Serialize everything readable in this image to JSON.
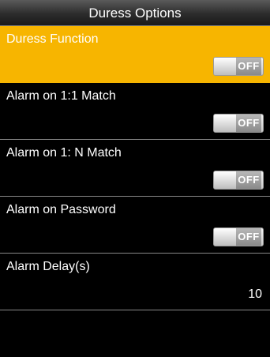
{
  "title": "Duress Options",
  "items": [
    {
      "label": "Duress Function",
      "toggle": "OFF",
      "selected": true
    },
    {
      "label": "Alarm on 1:1 Match",
      "toggle": "OFF",
      "selected": false
    },
    {
      "label": "Alarm on 1: N Match",
      "toggle": "OFF",
      "selected": false
    },
    {
      "label": "Alarm on Password",
      "toggle": "OFF",
      "selected": false
    },
    {
      "label": "Alarm Delay(s)",
      "value": "10",
      "selected": false
    }
  ],
  "colors": {
    "highlight": "#f7b500",
    "background": "#000000",
    "text": "#ffffff"
  }
}
